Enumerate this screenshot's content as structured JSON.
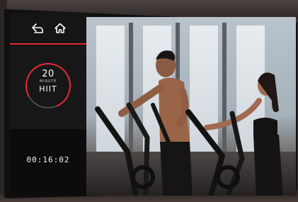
{
  "nav": {
    "back_icon": "back-arrow-icon",
    "home_icon": "home-icon"
  },
  "workout": {
    "duration": "20",
    "unit": "MINUTE",
    "type": "HIIT"
  },
  "timer": {
    "elapsed": "00:16:02"
  },
  "colors": {
    "accent": "#e8283c",
    "panel": "#0c0c0c",
    "card": "#171717",
    "text": "#ffffff"
  }
}
